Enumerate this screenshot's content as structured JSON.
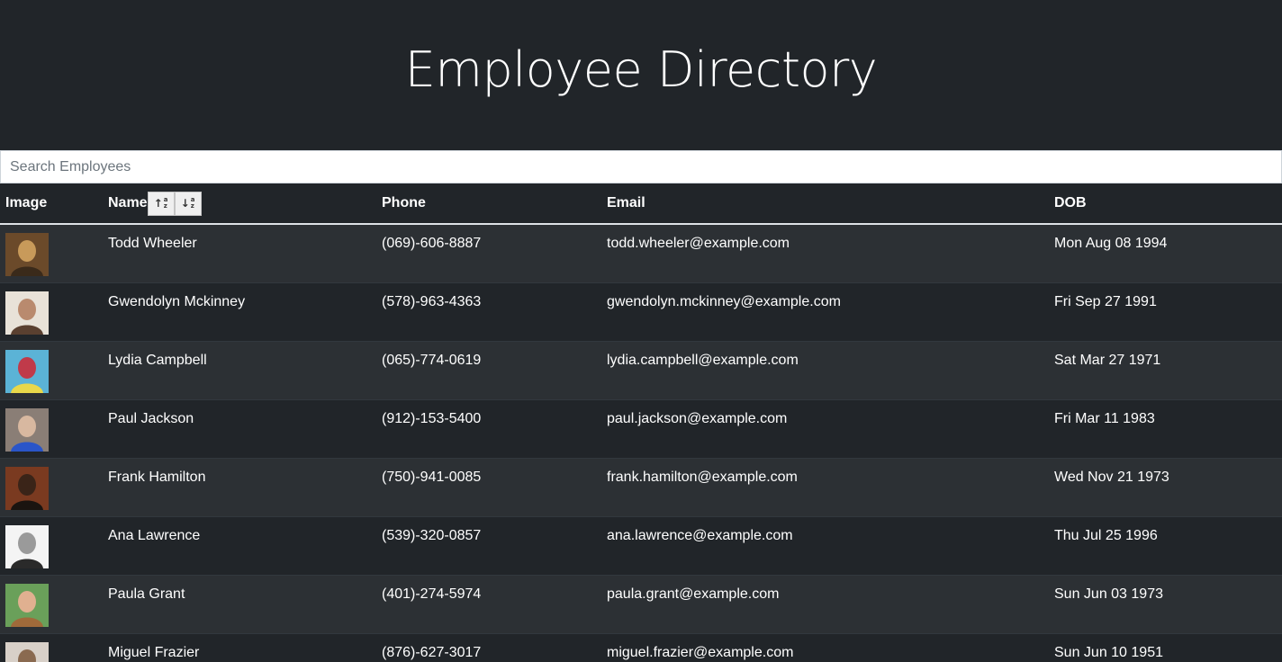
{
  "header": {
    "title": "Employee Directory"
  },
  "search": {
    "placeholder": "Search Employees",
    "value": ""
  },
  "table": {
    "columns": {
      "image": "Image",
      "name": "Name",
      "phone": "Phone",
      "email": "Email",
      "dob": "DOB"
    },
    "sort_buttons": [
      {
        "name": "sort-ascending-icon",
        "glyph": "↑"
      },
      {
        "name": "sort-descending-icon",
        "glyph": "↓"
      }
    ],
    "rows": [
      {
        "name": "Todd Wheeler",
        "phone": "(069)-606-8887",
        "email": "todd.wheeler@example.com",
        "dob": "Mon Aug 08 1994",
        "avatar_colors": [
          "#6b4a2a",
          "#c89a5a",
          "#3a2a1a"
        ]
      },
      {
        "name": "Gwendolyn Mckinney",
        "phone": "(578)-963-4363",
        "email": "gwendolyn.mckinney@example.com",
        "dob": "Fri Sep 27 1991",
        "avatar_colors": [
          "#e8e2d8",
          "#b98a6e",
          "#5a4030"
        ]
      },
      {
        "name": "Lydia Campbell",
        "phone": "(065)-774-0619",
        "email": "lydia.campbell@example.com",
        "dob": "Sat Mar 27 1971",
        "avatar_colors": [
          "#5bb3d6",
          "#c03a4a",
          "#e8d84a"
        ]
      },
      {
        "name": "Paul Jackson",
        "phone": "(912)-153-5400",
        "email": "paul.jackson@example.com",
        "dob": "Fri Mar 11 1983",
        "avatar_colors": [
          "#8a7e76",
          "#d8b8a0",
          "#2a55c8"
        ]
      },
      {
        "name": "Frank Hamilton",
        "phone": "(750)-941-0085",
        "email": "frank.hamilton@example.com",
        "dob": "Wed Nov 21 1973",
        "avatar_colors": [
          "#7a3a20",
          "#3a2418",
          "#1a1410"
        ]
      },
      {
        "name": "Ana Lawrence",
        "phone": "(539)-320-0857",
        "email": "ana.lawrence@example.com",
        "dob": "Thu Jul 25 1996",
        "avatar_colors": [
          "#f4f4f4",
          "#9a9a9a",
          "#2a2a2a"
        ]
      },
      {
        "name": "Paula Grant",
        "phone": "(401)-274-5974",
        "email": "paula.grant@example.com",
        "dob": "Sun Jun 03 1973",
        "avatar_colors": [
          "#6aa05a",
          "#e0b090",
          "#a06a3a"
        ]
      },
      {
        "name": "Miguel Frazier",
        "phone": "(876)-627-3017",
        "email": "miguel.frazier@example.com",
        "dob": "Sun Jun 10 1951",
        "avatar_colors": [
          "#d8d0c8",
          "#8a6a50",
          "#4a3a30"
        ]
      }
    ]
  },
  "colors": {
    "background": "#212529",
    "row_stripe": "#2c3034",
    "text": "#ffffff"
  }
}
